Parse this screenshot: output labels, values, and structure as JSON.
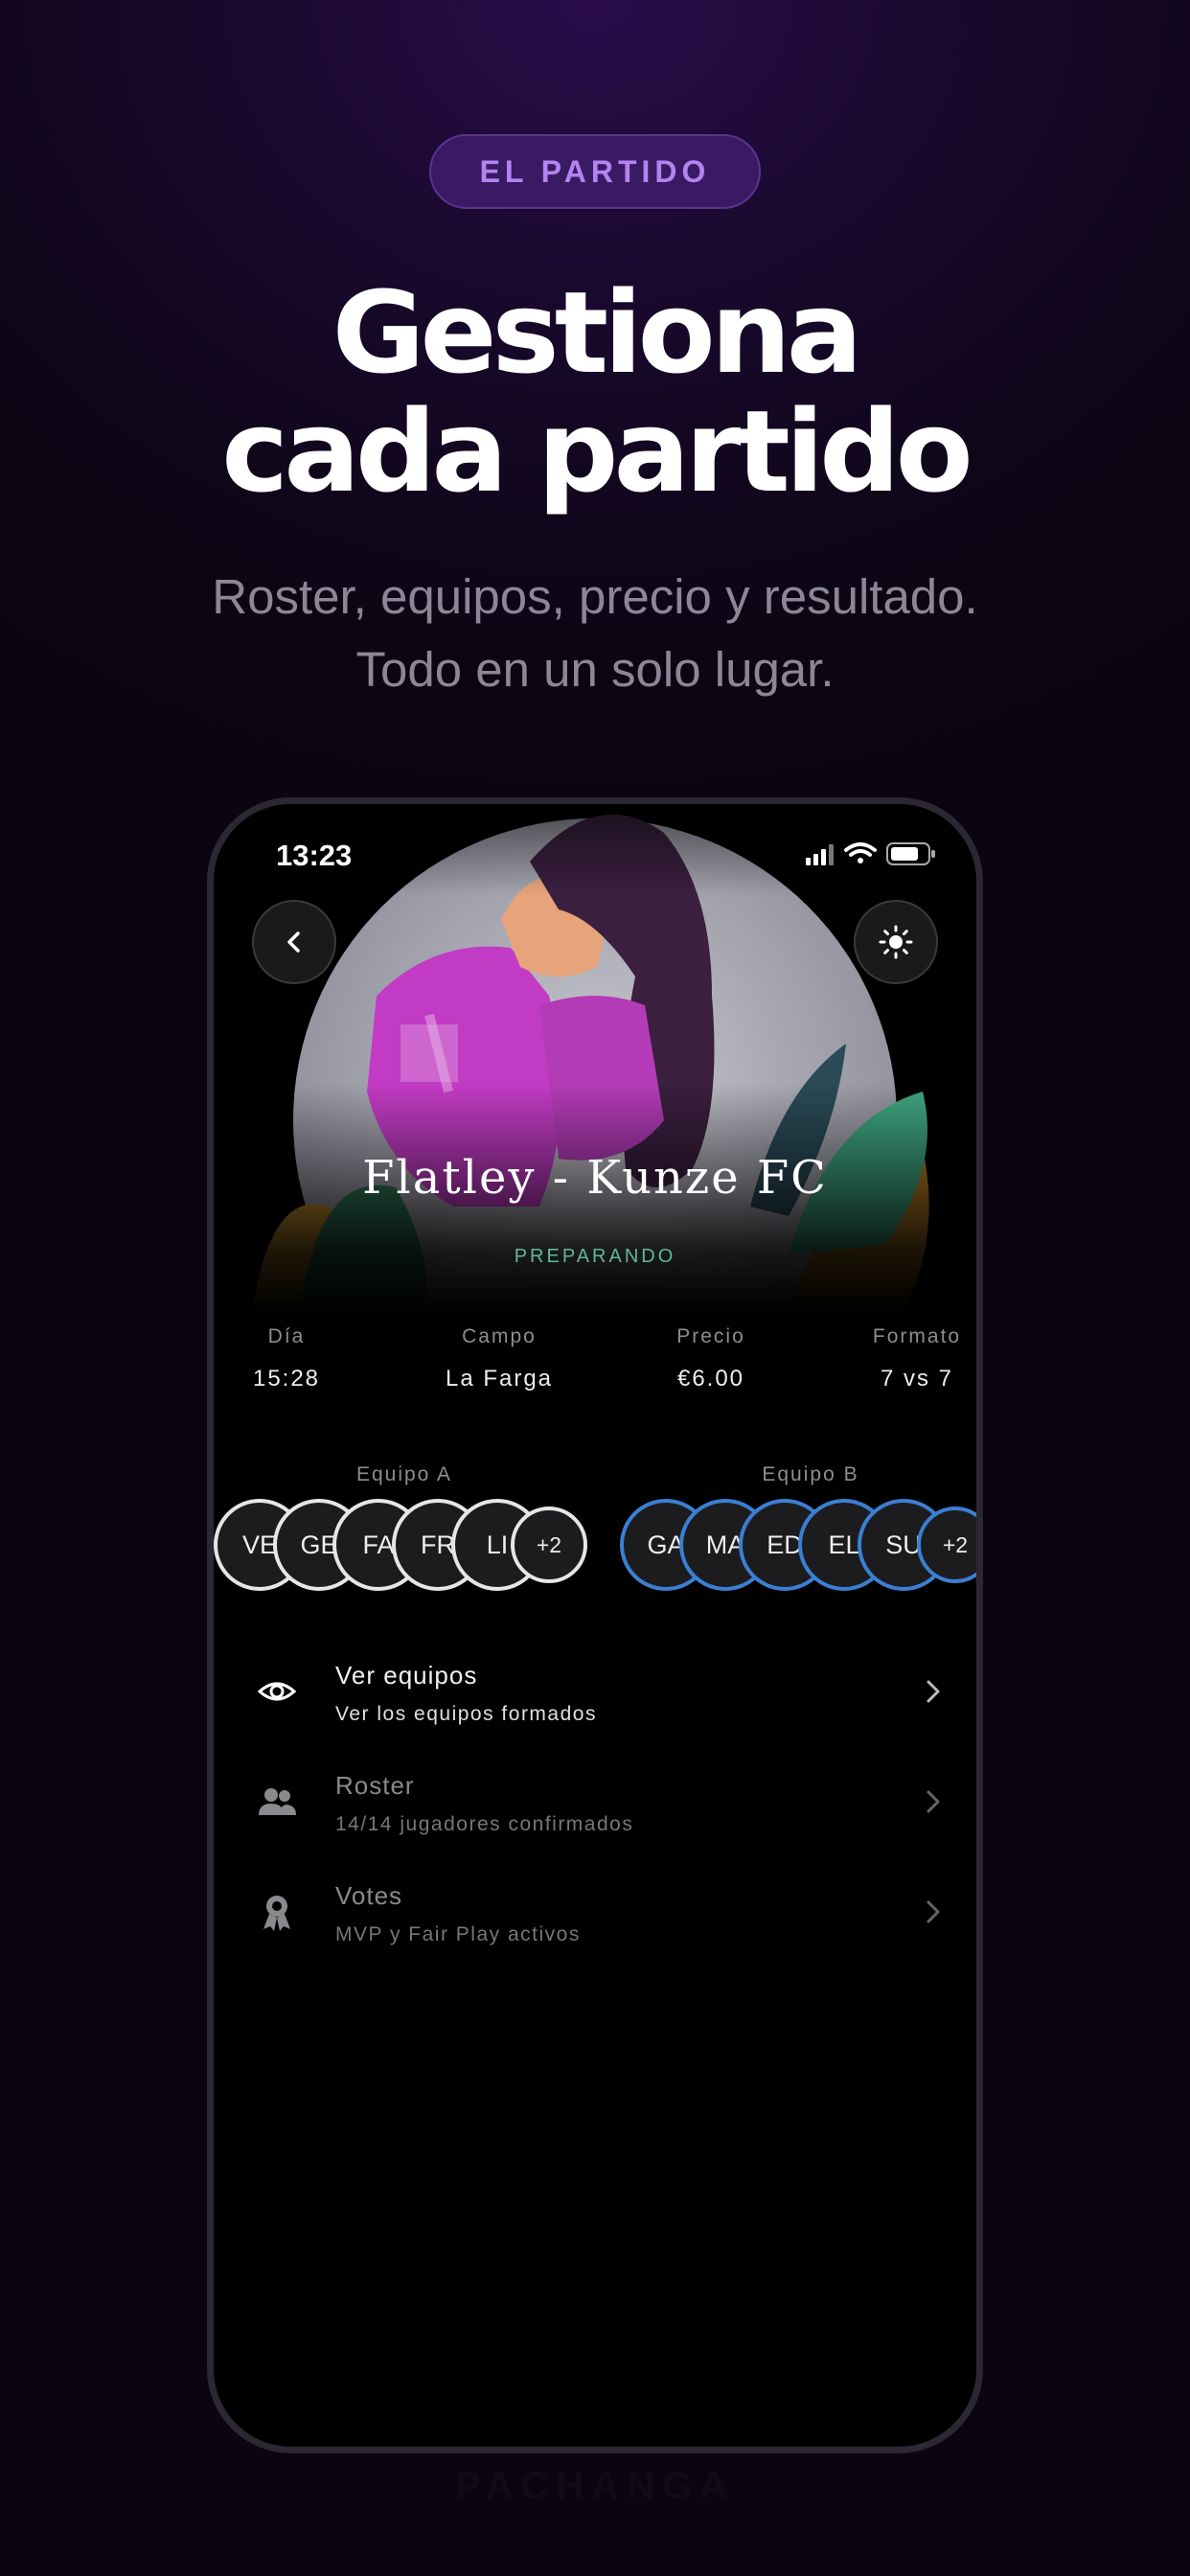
{
  "badge": "EL PARTIDO",
  "headline": {
    "line1": "Gestiona",
    "line2": "cada partido"
  },
  "subtitle": {
    "line1": "Roster, equipos, precio y resultado.",
    "line2": "Todo en un solo lugar."
  },
  "phone": {
    "status_time": "13:23",
    "back_icon": "chevron-left-icon",
    "theme_icon": "sun-icon",
    "match": {
      "title": "Flatley - Kunze FC",
      "status": "PREPARANDO"
    },
    "info": [
      {
        "label": "Día",
        "value": "15:28"
      },
      {
        "label": "Campo",
        "value": "La Farga"
      },
      {
        "label": "Precio",
        "value": "€6.00"
      },
      {
        "label": "Formato",
        "value": "7 vs 7"
      }
    ],
    "team_a": {
      "label": "Equipo A",
      "players": [
        "VE",
        "GE",
        "FA",
        "FR",
        "LI"
      ],
      "more": "+2",
      "color": "#e6e6e6"
    },
    "team_b": {
      "label": "Equipo B",
      "players": [
        "GA",
        "MA",
        "ED",
        "EL",
        "SU"
      ],
      "more": "+2",
      "color": "#3b7fd3"
    },
    "menu": [
      {
        "title": "Ver equipos",
        "subtitle": "Ver los equipos formados",
        "icon": "eye-icon"
      },
      {
        "title": "Roster",
        "subtitle": "14/14 jugadores confirmados",
        "icon": "people-icon"
      },
      {
        "title": "Votes",
        "subtitle": "MVP y Fair Play activos",
        "icon": "award-icon"
      }
    ]
  },
  "brand": "PACHANGA"
}
